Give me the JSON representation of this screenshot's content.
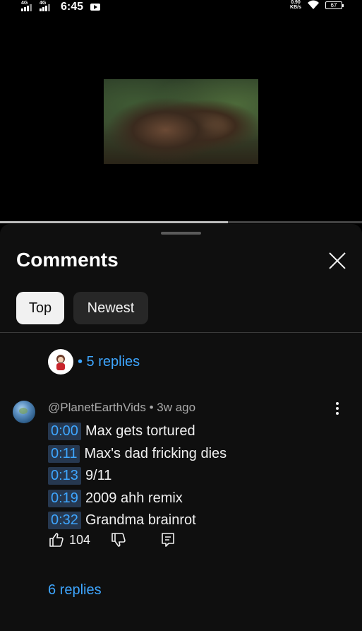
{
  "status_bar": {
    "network_left": "4G",
    "network_right": "4G",
    "time": "6:45",
    "speed_value": "0.90",
    "speed_unit": "KB/s",
    "battery": "67"
  },
  "video": {
    "progress_fraction": 0.63
  },
  "comments_panel": {
    "title": "Comments",
    "filters": [
      "Top",
      "Newest"
    ],
    "selected_filter": "Top",
    "pinned_reply_link": "• 5 replies",
    "comment": {
      "author": "@PlanetEarthVids",
      "age": "3w ago",
      "separator": " • ",
      "timestamps": [
        {
          "time": "0:00",
          "text": "Max gets tortured"
        },
        {
          "time": "0:11",
          "text": "Max's dad fricking dies"
        },
        {
          "time": "0:13",
          "text": "9/11"
        },
        {
          "time": "0:19",
          "text": "2009 ahh remix"
        },
        {
          "time": "0:32",
          "text": "Grandma brainrot"
        }
      ],
      "likes": "104",
      "replies_label": "6 replies"
    }
  },
  "icons": {
    "close": "close-icon",
    "like": "thumbs-up-icon",
    "dislike": "thumbs-down-icon",
    "reply": "reply-icon",
    "more": "more-vert-icon"
  },
  "colors": {
    "accent_link": "#3ea6ff",
    "sheet_bg": "#0f0f0f",
    "chip_selected_bg": "#f1f1f1",
    "chip_bg": "#272727",
    "timestamp_bg": "#263850"
  }
}
